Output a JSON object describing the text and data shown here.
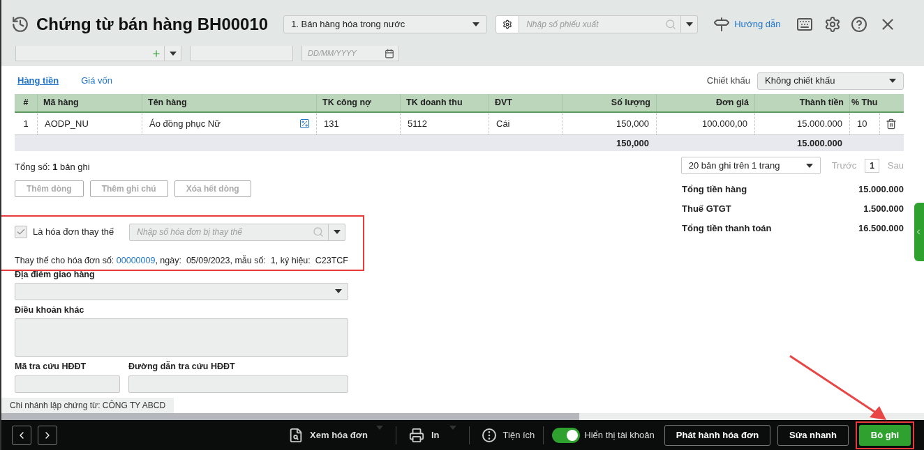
{
  "header": {
    "title": "Chứng từ bán hàng BH00010",
    "voucher_type": "1. Bán hàng hóa trong nước",
    "search_placeholder": "Nhập số phiếu xuất",
    "guide": "Hướng dẫn"
  },
  "top_fields": {
    "date_placeholder": "DD/MM/YYYY"
  },
  "tabs": [
    {
      "label": "Hàng tiền",
      "selected": true
    },
    {
      "label": "Giá vốn",
      "selected": false
    }
  ],
  "discount": {
    "label": "Chiết khấu",
    "value": "Không chiết khấu"
  },
  "table": {
    "columns": [
      "#",
      "Mã hàng",
      "Tên hàng",
      "TK công nợ",
      "TK doanh thu",
      "ĐVT",
      "Số lượng",
      "Đơn giá",
      "Thành tiền",
      "% Thu"
    ],
    "rows": [
      {
        "cells": [
          "1",
          "AODP_NU",
          "Áo đồng phục Nữ",
          "131",
          "5112",
          "Cái",
          "150,000",
          "100.000,00",
          "15.000.000",
          "10"
        ]
      }
    ],
    "totals": {
      "quantity": "150,000",
      "amount": "15.000.000"
    }
  },
  "record_count": "Tổng số: **1** bản ghi",
  "pagination": {
    "page_size": "20 bản ghi trên 1 trang",
    "prev": "Trước",
    "page": "1",
    "next": "Sau"
  },
  "row_buttons": [
    {
      "label": "Thêm dòng",
      "disabled": true
    },
    {
      "label": "Thêm ghi chú",
      "disabled": true
    },
    {
      "label": "Xóa hết dòng",
      "disabled": true
    }
  ],
  "replacement": {
    "checked": true,
    "label": "Là hóa đơn thay thế",
    "placeholder": "Nhập số hóa đơn bị thay thế",
    "info_prefix": "Thay thế cho hóa đơn số: ",
    "invoice_no": "00000009",
    "info_rest": ", ngày:  05/09/2023, mẫu số:  1, ký hiệu:  C23TCF"
  },
  "summary": [
    {
      "label": "Tổng tiền hàng",
      "value": "15.000.000"
    },
    {
      "label": "Thuế GTGT",
      "value": "1.500.000"
    },
    {
      "label": "Tổng tiền thanh toán",
      "value": "16.500.000"
    }
  ],
  "fields": {
    "delivery": "Địa điểm giao hàng",
    "terms": "Điều khoản khác",
    "lookup_code": "Mã tra cứu HĐĐT",
    "lookup_link": "Đường dẫn tra cứu HĐĐT"
  },
  "branch": "Chi nhánh lập chứng từ: CÔNG TY ABCD",
  "footer": {
    "view_invoice": "Xem hóa đơn",
    "print": "In",
    "utilities": "Tiện ích",
    "toggle": {
      "label": "Hiển thị tài khoản",
      "on": true
    },
    "buttons": [
      {
        "label": "Phát hành hóa đơn",
        "kind": "outline"
      },
      {
        "label": "Sửa nhanh",
        "kind": "outline"
      },
      {
        "label": "Bỏ ghi",
        "kind": "primary"
      }
    ]
  }
}
